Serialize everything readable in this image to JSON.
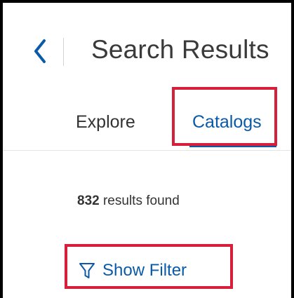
{
  "header": {
    "title": "Search Results",
    "back_icon": "chevron-left-icon"
  },
  "tabs": [
    {
      "label": "Explore",
      "selected": false
    },
    {
      "label": "Catalogs",
      "selected": true
    }
  ],
  "results": {
    "count": "832",
    "suffix": " results found"
  },
  "filter": {
    "label": "Show Filter",
    "icon": "funnel-icon"
  },
  "colors": {
    "accent": "#0a5aa8",
    "highlight": "#d61f3a",
    "text": "#333333"
  }
}
